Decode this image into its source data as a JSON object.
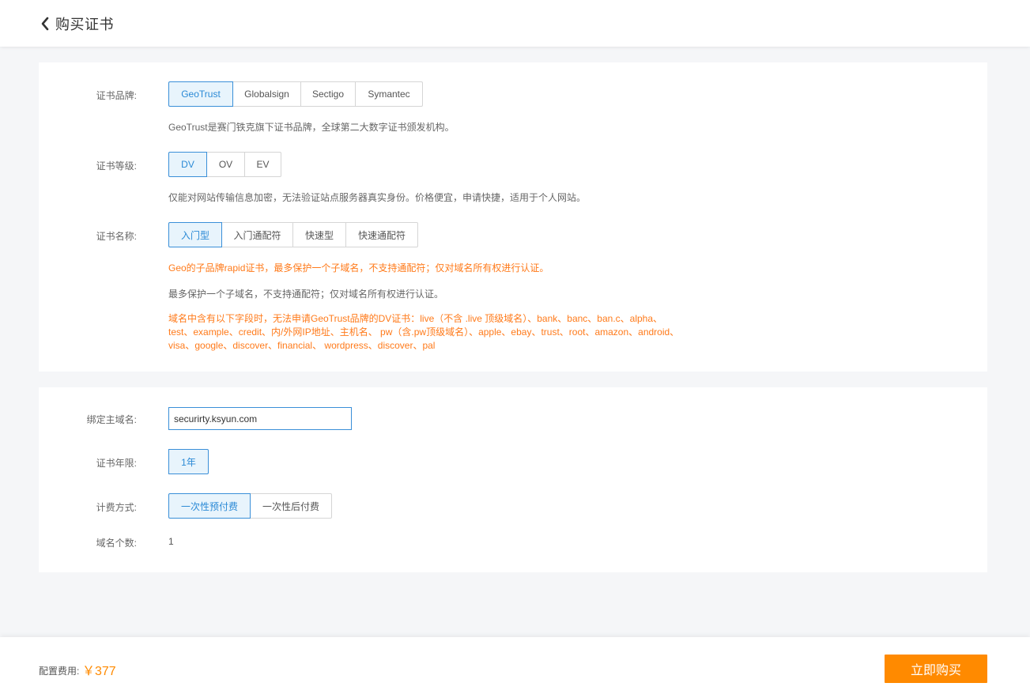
{
  "header": {
    "title": "购买证书",
    "back_icon": "chevron-left-icon"
  },
  "brand": {
    "label": "证书品牌:",
    "options": [
      "GeoTrust",
      "Globalsign",
      "Sectigo",
      "Symantec"
    ],
    "selected": "GeoTrust",
    "description": "GeoTrust是赛门铁克旗下证书品牌，全球第二大数字证书颁发机构。"
  },
  "level": {
    "label": "证书等级:",
    "options": [
      "DV",
      "OV",
      "EV"
    ],
    "selected": "DV",
    "description": "仅能对网站传输信息加密，无法验证站点服务器真实身份。价格便宜，申请快捷，适用于个人网站。"
  },
  "cert_name": {
    "label": "证书名称:",
    "options": [
      "入门型",
      "入门通配符",
      "快速型",
      "快速通配符"
    ],
    "selected": "入门型",
    "description_orange": "Geo的子品牌rapid证书，最多保护一个子域名，不支持通配符；仅对域名所有权进行认证。",
    "description": "最多保护一个子域名，不支持通配符；仅对域名所有权进行认证。",
    "warning_lines": [
      "域名中含有以下字段时，无法申请GeoTrust品牌的DV证书：live（不含 .live 顶级域名）、bank、banc、ban.c、alpha、",
      "test、example、credit、内/外网IP地址、主机名、 pw（含.pw顶级域名）、apple、ebay、trust、root、amazon、android、",
      "visa、google、discover、financial、 wordpress、discover、pal"
    ]
  },
  "domain": {
    "label": "绑定主域名:",
    "value": "securirty.ksyun.com"
  },
  "years": {
    "label": "证书年限:",
    "options": [
      "1年"
    ],
    "selected": "1年"
  },
  "billing": {
    "label": "计费方式:",
    "options": [
      "一次性预付费",
      "一次性后付费"
    ],
    "selected": "一次性预付费"
  },
  "domain_count": {
    "label": "域名个数:",
    "value": "1"
  },
  "footer": {
    "fee_label": "配置费用:",
    "fee_value": "￥377",
    "buy_label": "立即购买"
  },
  "colors": {
    "accent": "#3a8fd8",
    "orange": "#ff8a00",
    "warning_text": "#ff7a1a"
  }
}
